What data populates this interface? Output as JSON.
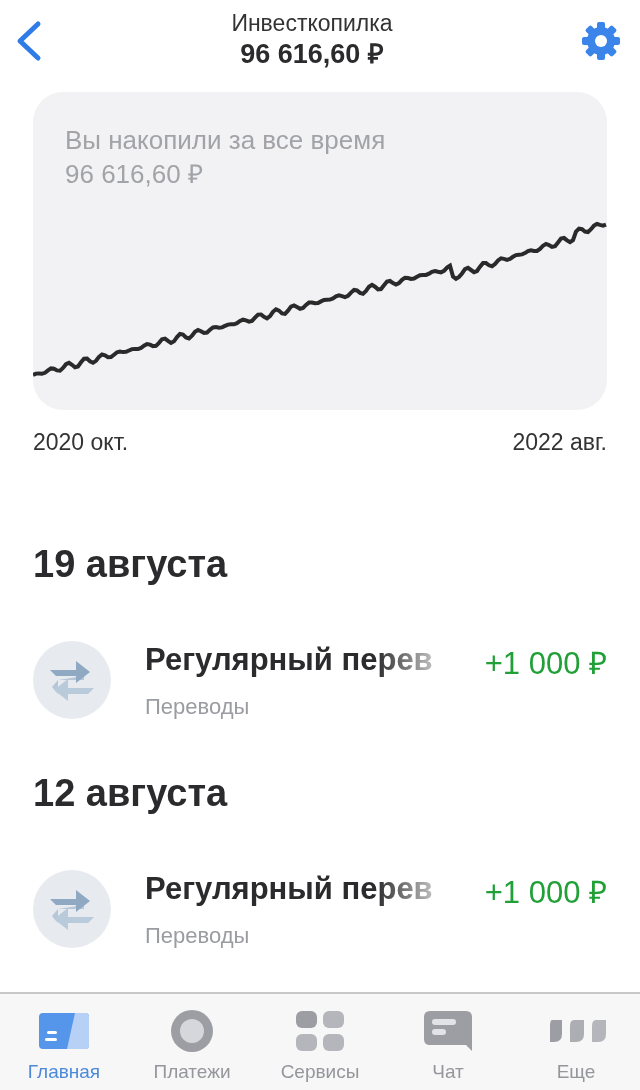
{
  "header": {
    "title": "Инвесткопилка",
    "amount": "96 616,60 ₽"
  },
  "summary": {
    "label": "Вы накопили за все время",
    "amount": "96 616,60 ₽",
    "start_label": "2020 окт.",
    "end_label": "2022 авг."
  },
  "groups": [
    {
      "date": "19 августа",
      "items": [
        {
          "title": "Регулярный перев",
          "category": "Переводы",
          "amount": "+1 000 ₽"
        }
      ]
    },
    {
      "date": "12 августа",
      "items": [
        {
          "title": "Регулярный перев",
          "category": "Переводы",
          "amount": "+1 000 ₽"
        }
      ]
    }
  ],
  "tabs": [
    {
      "label": "Главная",
      "selected": true
    },
    {
      "label": "Платежи",
      "selected": false
    },
    {
      "label": "Сервисы",
      "selected": false
    },
    {
      "label": "Чат",
      "selected": false
    },
    {
      "label": "Еще",
      "selected": false
    }
  ]
}
